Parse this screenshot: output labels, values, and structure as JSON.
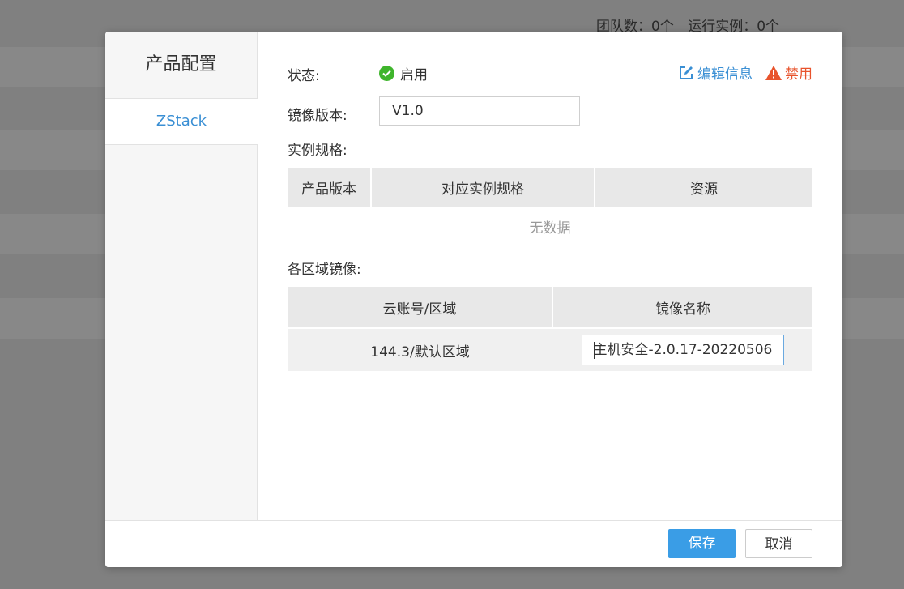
{
  "background": {
    "stats": {
      "teams": "团队数：0个",
      "running": "运行实例：0个"
    }
  },
  "dialog": {
    "sidebar": {
      "title": "产品配置",
      "items": [
        {
          "label": "ZStack"
        }
      ]
    },
    "status": {
      "label": "状态:",
      "value": "启用",
      "color": "#3fb52c"
    },
    "actions": {
      "edit": {
        "label": "编辑信息",
        "icon": "edit-icon",
        "color": "#3a8fd4"
      },
      "disable": {
        "label": "禁用",
        "icon": "warning-icon",
        "color": "#e8532c"
      }
    },
    "image_version": {
      "label": "镜像版本:",
      "value": "V1.0"
    },
    "instance_spec": {
      "label": "实例规格:",
      "columns": [
        "产品版本",
        "对应实例规格",
        "资源"
      ],
      "empty_text": "无数据"
    },
    "region_images": {
      "label": "各区域镜像:",
      "columns": [
        "云账号/区域",
        "镜像名称"
      ],
      "rows": [
        {
          "account_region": "144.3/默认区域",
          "image_name": "主机安全-2.0.17-20220506"
        }
      ]
    },
    "footer": {
      "save": "保存",
      "cancel": "取消"
    }
  }
}
